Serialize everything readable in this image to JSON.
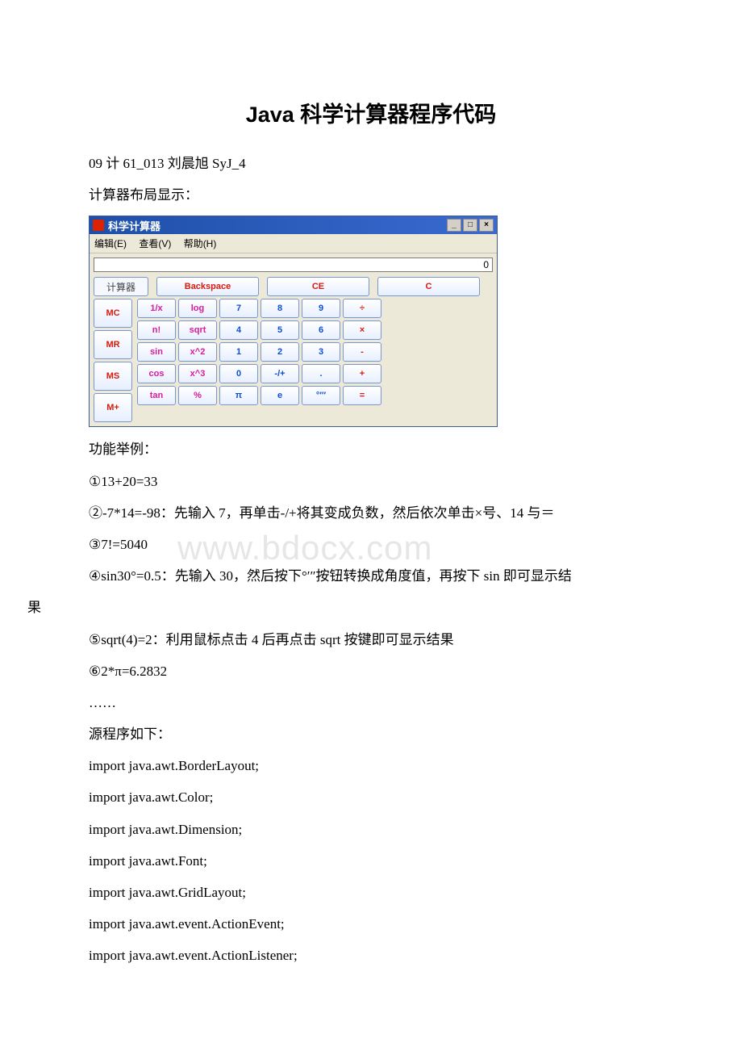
{
  "title": "Java 科学计算器程序代码",
  "subtitle": "09 计 61_013 刘晨旭 SyJ_4",
  "layout_label": "计算器布局显示：",
  "calc": {
    "window_title": "科学计算器",
    "menu": {
      "edit": "编辑(E)",
      "view": "查看(V)",
      "help": "帮助(H)"
    },
    "display_value": "0",
    "label_calc": "计算器",
    "backspace": "Backspace",
    "ce": "CE",
    "c": "C",
    "mem": [
      "MC",
      "MR",
      "MS",
      "M+"
    ],
    "fn": [
      [
        "1/x",
        "log"
      ],
      [
        "n!",
        "sqrt"
      ],
      [
        "sin",
        "x^2"
      ],
      [
        "cos",
        "x^3"
      ],
      [
        "tan",
        "%"
      ]
    ],
    "num": [
      [
        "7",
        "8",
        "9",
        "÷"
      ],
      [
        "4",
        "5",
        "6",
        "×"
      ],
      [
        "1",
        "2",
        "3",
        "-"
      ],
      [
        "0",
        "-/+",
        ".",
        "+"
      ],
      [
        "π",
        "e",
        "°′″",
        "="
      ]
    ]
  },
  "examples_label": "功能举例：",
  "ex1": "①13+20=33",
  "ex2": "②-7*14=-98：先输入 7，再单击-/+将其变成负数，然后依次单击×号、14 与＝",
  "ex3": "③7!=5040",
  "ex4a": "④sin30°=0.5：先输入 30，然后按下°′″按钮转换成角度值，再按下 sin 即可显示结",
  "ex4b": "果",
  "ex5": "⑤sqrt(4)=2：利用鼠标点击 4 后再点击 sqrt 按键即可显示结果",
  "ex6": "⑥2*π=6.2832",
  "dots": "……",
  "src_label": "源程序如下：",
  "code": [
    "import java.awt.BorderLayout;",
    "import java.awt.Color;",
    "import java.awt.Dimension;",
    "import java.awt.Font;",
    "import java.awt.GridLayout;",
    "import java.awt.event.ActionEvent;",
    "import java.awt.event.ActionListener;"
  ],
  "watermark": "www.bdocx.com"
}
